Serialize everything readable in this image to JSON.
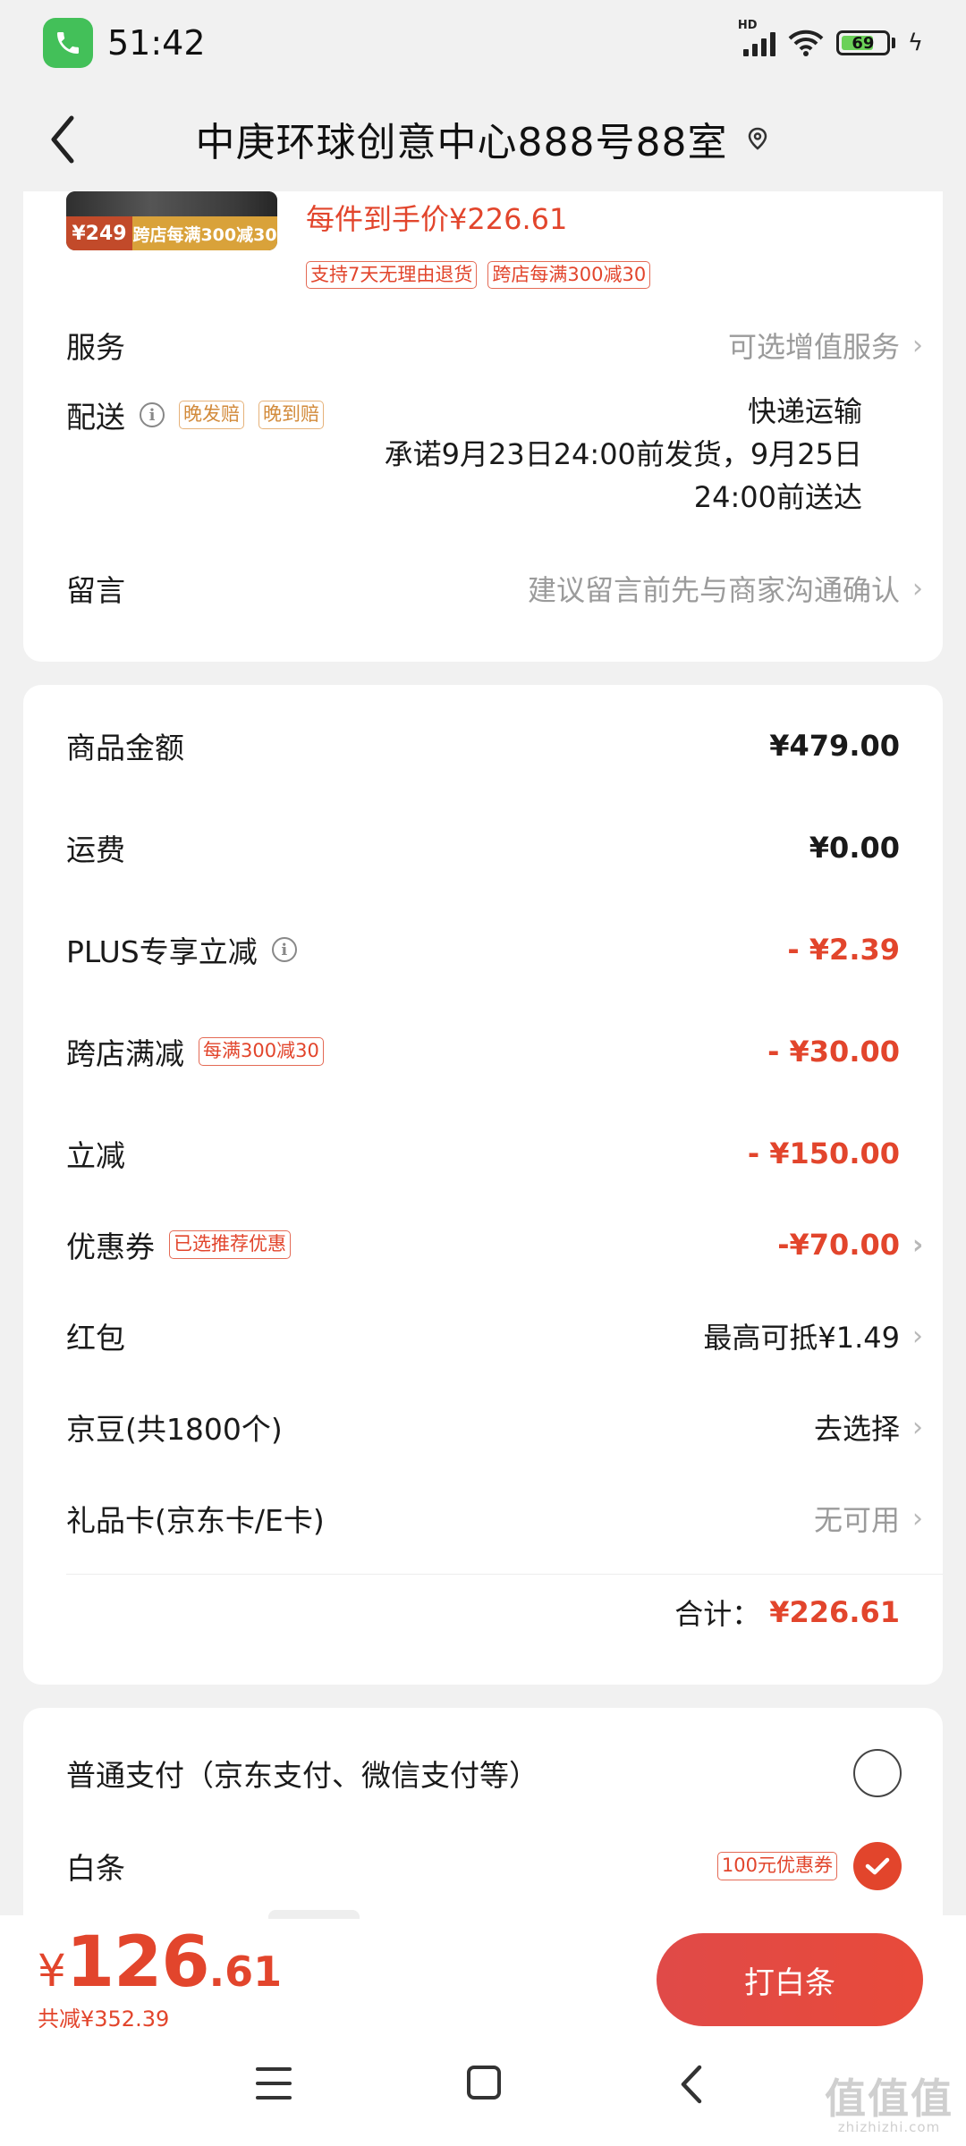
{
  "status": {
    "time": "51:42",
    "battery": "69",
    "network": "HD"
  },
  "header": {
    "title": "中庚环球创意中心888号88室"
  },
  "product": {
    "thumb_price": "¥249",
    "thumb_promo": "跨店每满300减30",
    "unit_price": "每件到手价¥226.61",
    "tags": [
      "支持7天无理由退货",
      "跨店每满300减30"
    ]
  },
  "service": {
    "label": "服务",
    "value": "可选增值服务"
  },
  "delivery": {
    "label": "配送",
    "tags": [
      "晚发赔",
      "晚到赔"
    ],
    "method": "快递运输",
    "promise_line1": "承诺9月23日24:00前发货，9月25日",
    "promise_line2": "24:00前送达"
  },
  "message": {
    "label": "留言",
    "placeholder": "建议留言前先与商家沟通确认"
  },
  "summary": {
    "goods": {
      "label": "商品金额",
      "value": "¥479.00"
    },
    "shipping": {
      "label": "运费",
      "value": "¥0.00"
    },
    "plus": {
      "label": "PLUS专享立减",
      "value": "- ¥2.39"
    },
    "crossstore": {
      "label": "跨店满减",
      "tag": "每满300减30",
      "value": "- ¥30.00"
    },
    "direct": {
      "label": "立减",
      "value": "- ¥150.00"
    },
    "coupon": {
      "label": "优惠券",
      "tag": "已选推荐优惠",
      "value": "-¥70.00"
    },
    "redpacket": {
      "label": "红包",
      "value": "最高可抵¥1.49"
    },
    "beans": {
      "label": "京豆(共1800个)",
      "value": "去选择"
    },
    "giftcard": {
      "label": "礼品卡(京东卡/E卡)",
      "value": "无可用"
    },
    "total_label": "合计：",
    "total_value": "¥226.61"
  },
  "payment": {
    "normal": {
      "label": "普通支付（京东支付、微信支付等）",
      "selected": false
    },
    "baitiao": {
      "label": "白条",
      "tag": "100元优惠券",
      "selected": true
    }
  },
  "bottom": {
    "yen": "¥",
    "amount_int": "126",
    "amount_dec": ".61",
    "saved": "共减¥352.39",
    "pay_button": "打白条"
  },
  "watermark": {
    "big": "值值值",
    "small": "zhizhizhi.com"
  },
  "colors": {
    "accent": "#e2452c",
    "background": "#f1f1f1"
  }
}
